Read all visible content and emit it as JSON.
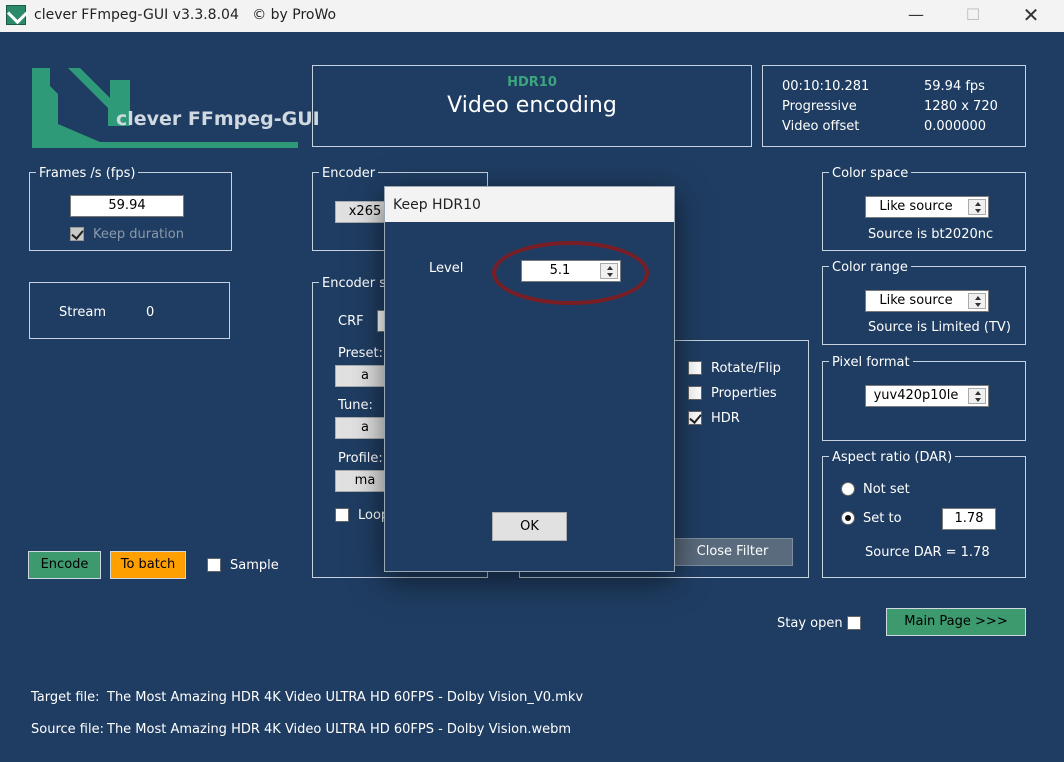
{
  "window": {
    "title": "clever FFmpeg-GUI v3.3.8.04   © by ProWo",
    "minimize_icon": "minimize-icon",
    "maximize_icon": "maximize-icon",
    "close_icon": "close-icon"
  },
  "logo": {
    "text": "clever FFmpeg-GUI"
  },
  "header": {
    "subtitle": "HDR10",
    "title": "Video encoding"
  },
  "info": {
    "duration": "00:10:10.281",
    "fps": "59.94 fps",
    "scan": "Progressive",
    "resolution": "1280 x 720",
    "offset_label": "Video offset",
    "offset_value": "0.000000"
  },
  "frames": {
    "label": "Frames /s (fps)",
    "value": "59.94",
    "keep_duration": "Keep duration"
  },
  "stream": {
    "label": "Stream",
    "value": "0"
  },
  "encoder": {
    "label": "Encoder",
    "value": "x265"
  },
  "encoder_settings": {
    "label": "Encoder s",
    "crf": "CRF",
    "preset": "Preset:",
    "preset_value": "a",
    "tune": "Tune:",
    "tune_value": "a",
    "profile": "Profile:",
    "profile_value": "ma",
    "loop": "Loop"
  },
  "filters": {
    "rotate": "Rotate/Flip",
    "properties": "Properties",
    "hdr": "HDR",
    "close_filter": "Close Filter"
  },
  "color_space": {
    "label": "Color space",
    "value": "Like source",
    "source": "Source is bt2020nc"
  },
  "color_range": {
    "label": "Color range",
    "value": "Like source",
    "source": "Source is Limited (TV)"
  },
  "pixel_format": {
    "label": "Pixel format",
    "value": "yuv420p10le"
  },
  "aspect": {
    "label": "Aspect ratio (DAR)",
    "not_set": "Not set",
    "set_to": "Set to",
    "value": "1.78",
    "source": "Source DAR = 1.78"
  },
  "actions": {
    "encode": "Encode",
    "to_batch": "To batch",
    "sample": "Sample",
    "stay_open": "Stay open",
    "main_page": "Main Page >>>"
  },
  "files": {
    "target_label": "Target file:",
    "target": "The Most Amazing HDR 4K Video ULTRA HD 60FPS - Dolby Vision_V0.mkv",
    "source_label": "Source file:",
    "source": "The Most Amazing HDR 4K Video ULTRA HD 60FPS - Dolby Vision.webm"
  },
  "dialog": {
    "title": "Keep HDR10",
    "level_label": "Level",
    "level_value": "5.1",
    "ok": "OK"
  },
  "colors": {
    "background": "#1f3d62",
    "encode_button": "#3d9a6f",
    "batch_button": "#ff9f00",
    "logo": "#2e9a78",
    "highlight": "#7a1e26"
  }
}
